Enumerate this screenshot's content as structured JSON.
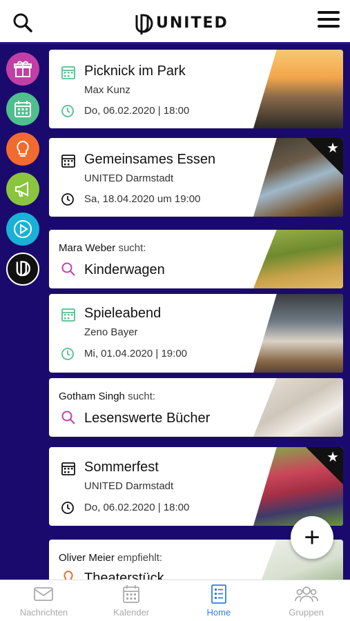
{
  "header": {
    "logo_text": "UNITED",
    "search_icon": "search-icon",
    "menu_icon": "hamburger-menu-icon"
  },
  "sidebar": {
    "items": [
      {
        "name": "gift-icon",
        "color": "#c23fa5"
      },
      {
        "name": "calendar-icon",
        "color": "#4fc08d"
      },
      {
        "name": "lightbulb-icon",
        "color": "#f26b2e"
      },
      {
        "name": "megaphone-icon",
        "color": "#8bc53f"
      },
      {
        "name": "play-icon",
        "color": "#1ab1d6"
      },
      {
        "name": "united-logo-icon",
        "color": "#111111"
      }
    ]
  },
  "feed": {
    "cards": [
      {
        "type": "event",
        "title": "Picknick im Park",
        "subtitle": "Max Kunz",
        "date": "Do, 06.02.2020 | 18:00",
        "icon_style": "green",
        "favorite": false
      },
      {
        "type": "event",
        "title": "Gemeinsames Essen",
        "subtitle": "UNITED Darmstadt",
        "date": "Sa, 18.04.2020 um 19:00",
        "icon_style": "black",
        "favorite": true
      },
      {
        "type": "request",
        "user": "Mara Weber",
        "verb": "sucht:",
        "query": "Kinderwagen"
      },
      {
        "type": "event",
        "title": "Spieleabend",
        "subtitle": "Zeno Bayer",
        "date": "Mi, 01.04.2020 | 19:00",
        "icon_style": "green",
        "favorite": false
      },
      {
        "type": "request",
        "user": "Gotham Singh",
        "verb": "sucht:",
        "query": "Lesenswerte Bücher"
      },
      {
        "type": "event",
        "title": "Sommerfest",
        "subtitle": "UNITED Darmstadt",
        "date": "Do, 06.02.2020 | 18:00",
        "icon_style": "black",
        "favorite": true
      },
      {
        "type": "recommend",
        "user": "Oliver Meier",
        "verb": "empfiehlt:",
        "query": "Theaterstück"
      }
    ]
  },
  "fab": {
    "label": "+"
  },
  "tabbar": {
    "tabs": [
      {
        "label": "Nachrichten",
        "icon": "mail-icon",
        "active": false
      },
      {
        "label": "Kalender",
        "icon": "calendar-icon",
        "active": false
      },
      {
        "label": "Home",
        "icon": "list-icon",
        "active": true
      },
      {
        "label": "Gruppen",
        "icon": "group-icon",
        "active": false
      }
    ]
  },
  "colors": {
    "background": "#1b0a6e",
    "accent": "#2f7fe0",
    "event_green": "#4fc08d",
    "search_pink": "#c23fa5"
  }
}
